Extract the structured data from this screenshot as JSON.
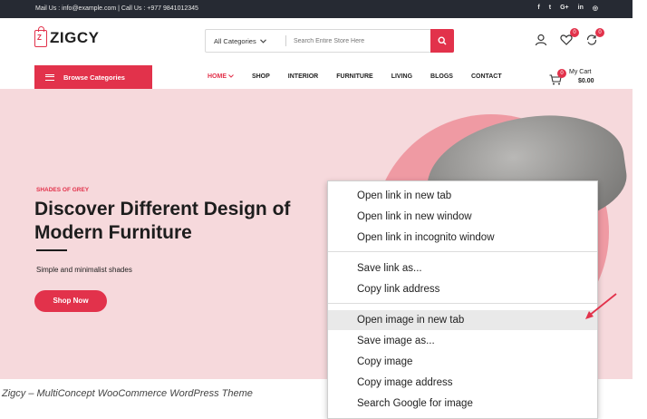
{
  "topbar": {
    "contact": "Mail Us : info@example.com | Call Us : +977 9841012345",
    "socials": [
      "f",
      "t",
      "G+",
      "in",
      "◎"
    ]
  },
  "logo": {
    "name": "ZIGCY",
    "mark": "Z"
  },
  "search": {
    "category": "All Categories",
    "placeholder": "Search Entire Store Here"
  },
  "header_icons": {
    "wishlist_count": "0",
    "compare_count": "0"
  },
  "browse": {
    "label": "Browse Categories"
  },
  "nav": {
    "items": [
      "HOME",
      "SHOP",
      "INTERIOR",
      "FURNITURE",
      "LIVING",
      "BLOGS",
      "CONTACT"
    ],
    "active": "HOME"
  },
  "cart": {
    "count": "0",
    "label": "My Cart",
    "amount": "$0.00"
  },
  "hero": {
    "eyebrow": "SHADES OF GREY",
    "title": "Discover Different Design of Modern Furniture",
    "subtitle": "Simple and minimalist shades",
    "button": "Shop Now"
  },
  "caption": "Zigcy – MultiConcept WooCommerce WordPress Theme",
  "context_menu": {
    "items": [
      "Open link in new tab",
      "Open link in new window",
      "Open link in incognito window",
      "Save link as...",
      "Copy link address",
      "Open image in new tab",
      "Save image as...",
      "Copy image",
      "Copy image address",
      "Search Google for image"
    ],
    "highlighted": "Open image in new tab"
  },
  "colors": {
    "accent": "#e2324b",
    "topbar": "#262a33",
    "hero_bg": "#f6d9dc",
    "circle": "#ef9aa3"
  }
}
